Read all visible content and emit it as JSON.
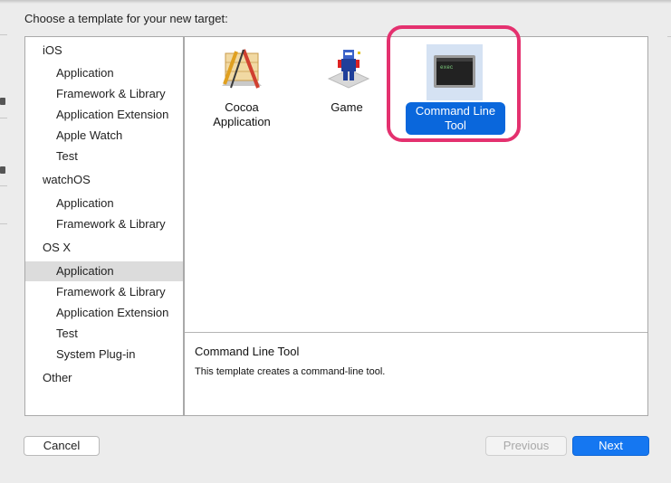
{
  "dialog": {
    "title": "Choose a template for your new target:"
  },
  "sidebar": {
    "groups": [
      {
        "label": "iOS",
        "items": [
          "Application",
          "Framework & Library",
          "Application Extension",
          "Apple Watch",
          "Test"
        ]
      },
      {
        "label": "watchOS",
        "items": [
          "Application",
          "Framework & Library"
        ]
      },
      {
        "label": "OS X",
        "items": [
          "Application",
          "Framework & Library",
          "Application Extension",
          "Test",
          "System Plug-in"
        ]
      },
      {
        "label": "Other",
        "items": []
      }
    ],
    "selected": "OS X / Application"
  },
  "templates": [
    {
      "label_line1": "Cocoa",
      "label_line2": "Application",
      "icon": "cocoa-app-icon"
    },
    {
      "label_line1": "Game",
      "label_line2": "",
      "icon": "game-icon"
    },
    {
      "label_line1": "Command Line",
      "label_line2": "Tool",
      "icon": "terminal-exec-icon",
      "icon_text": "exec",
      "selected": true
    }
  ],
  "description": {
    "title": "Command Line Tool",
    "text": "This template creates a command-line tool."
  },
  "buttons": {
    "cancel": "Cancel",
    "previous": "Previous",
    "next": "Next"
  },
  "colors": {
    "accent": "#1577f1",
    "selection_label": "#0a67dc",
    "highlight_ring": "#e4316f",
    "sidebar_selected": "#dcdcdc"
  }
}
